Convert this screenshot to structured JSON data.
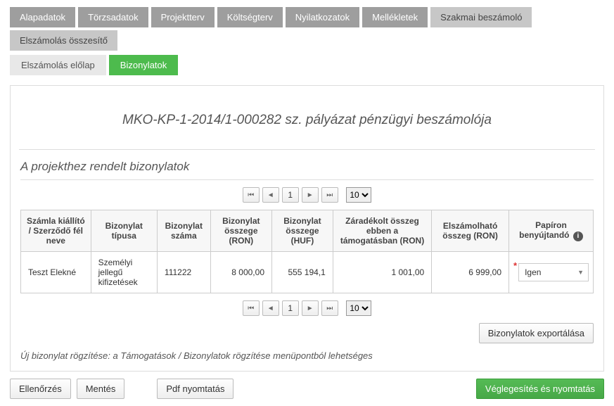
{
  "primaryTabs": [
    "Alapadatok",
    "Törzsadatok",
    "Projektterv",
    "Költségterv",
    "Nyilatkozatok",
    "Mellékletek",
    "Szakmai beszámoló",
    "Elszámolás összesítő"
  ],
  "secondaryTabs": {
    "t0": "Elszámolás előlap",
    "t1": "Bizonylatok"
  },
  "title": "MKO-KP-1-2014/1-000282 sz. pályázat pénzügyi beszámolója",
  "sectionTitle": "A projekthez rendelt bizonylatok",
  "pager": {
    "page": "1",
    "pageSize": "10"
  },
  "headers": {
    "c0": "Számla kiállító / Szerződő fél neve",
    "c1": "Bizonylat típusa",
    "c2": "Bizonylat száma",
    "c3": "Bizonylat összege (RON)",
    "c4": "Bizonylat összege (HUF)",
    "c5": "Záradékolt összeg ebben a támogatásban (RON)",
    "c6": "Elszámolható összeg (RON)",
    "c7": "Papíron benyújtandó"
  },
  "row": {
    "issuer": "Teszt Elekné",
    "type": "Személyi jellegű kifizetések",
    "number": "111222",
    "amountRon": "8 000,00",
    "amountHuf": "555 194,1",
    "endorsedRon": "1 001,00",
    "eligibleRon": "6 999,00",
    "paperSelected": "Igen"
  },
  "exportBtn": "Bizonylatok exportálása",
  "note": "Új bizonylat rögzítése: a Támogatások / Bizonylatok rögzítése menüpontból lehetséges",
  "footer": {
    "check": "Ellenőrzés",
    "save": "Mentés",
    "pdf": "Pdf nyomtatás",
    "finalize": "Véglegesítés és nyomtatás"
  }
}
